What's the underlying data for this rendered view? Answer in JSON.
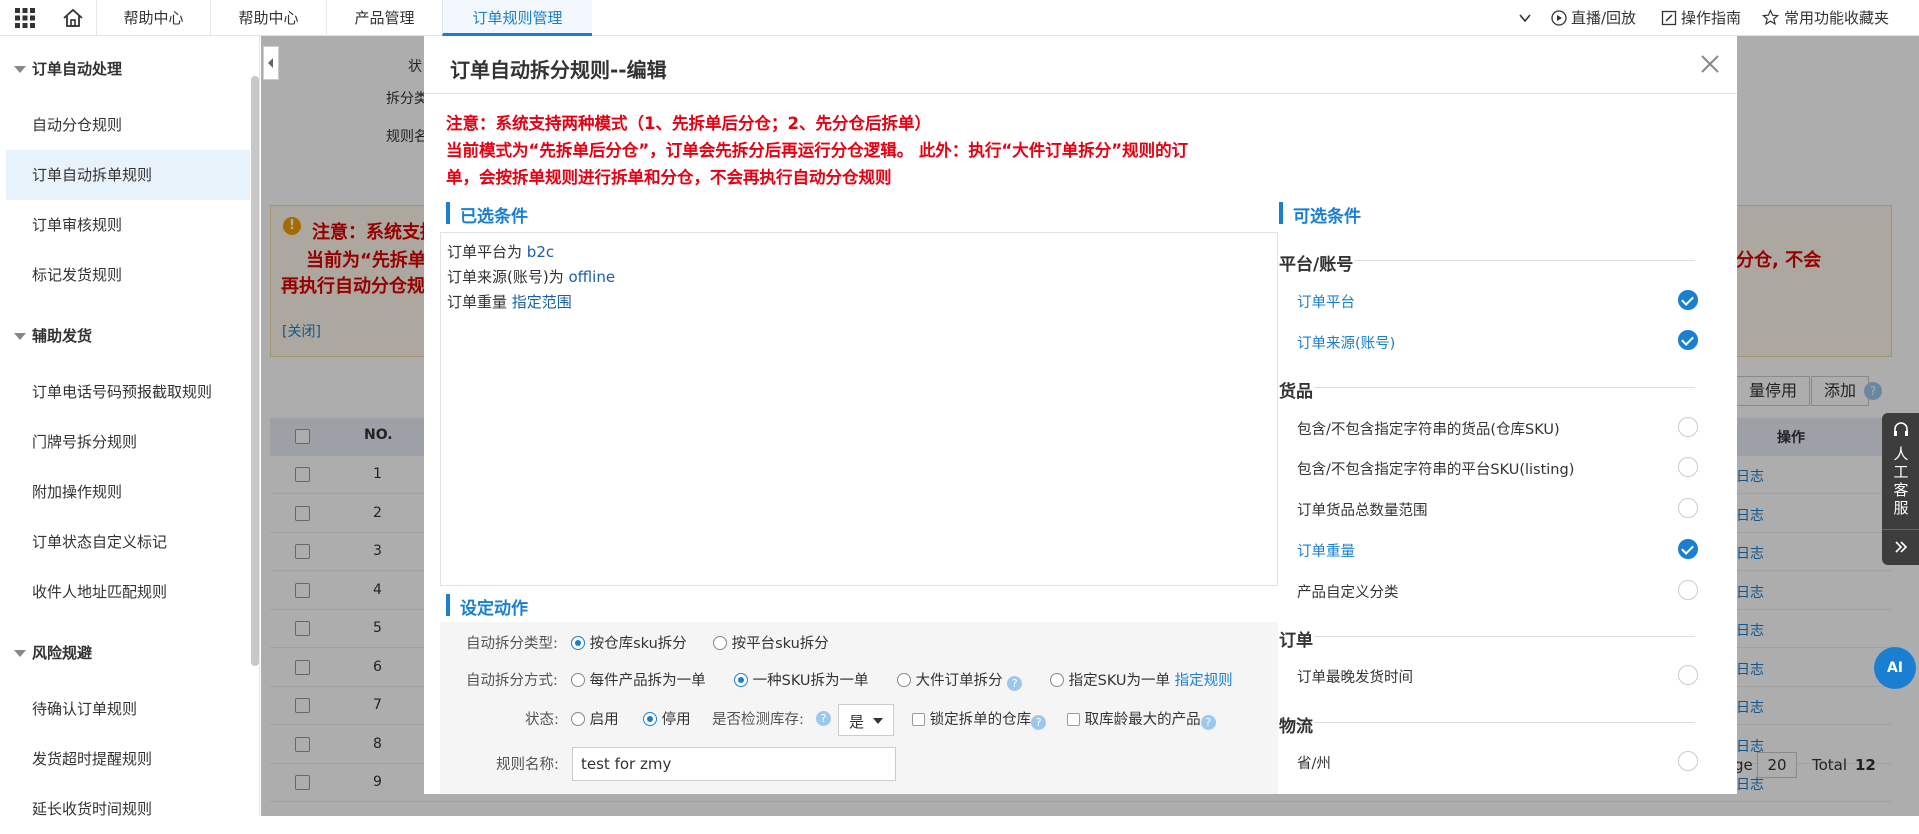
{
  "topbar": {
    "tabs": [
      "帮助中心",
      "帮助中心",
      "产品管理",
      "订单规则管理"
    ],
    "right": [
      "直播/回放",
      "操作指南",
      "常用功能收藏夹"
    ]
  },
  "sidebar": {
    "groups": [
      "订单自动处理",
      "辅助发货",
      "风险规避"
    ],
    "items1": [
      "自动分仓规则",
      "订单自动拆单规则",
      "订单审核规则",
      "标记发货规则"
    ],
    "items2": [
      "订单电话号码预报截取规则",
      "门牌号拆分规则",
      "附加操作规则",
      "订单状态自定义标记",
      "收件人地址匹配规则"
    ],
    "items3": [
      "待确认订单规则",
      "发货超时提醒规则",
      "延长收货时间规则"
    ]
  },
  "background": {
    "labels": [
      "状",
      "拆分类",
      "规则名"
    ],
    "notice_title": "注意：系统支持",
    "notice_line2": "当前为“先拆单",
    "notice_line3": "再执行自动分仓规则",
    "notice_right": "分仓, 不会",
    "close_link": "[关闭]",
    "btn_disable": "量停用",
    "btn_add": "添加",
    "col_no": "NO.",
    "col_op": "操作",
    "rows": [
      "1",
      "2",
      "3",
      "4",
      "5",
      "6",
      "7",
      "8",
      "9"
    ],
    "row_link": "日志",
    "pager_prefix": "ge",
    "page_size": "20",
    "total_label": "Total",
    "total": "12"
  },
  "modal": {
    "title": "订单自动拆分规则--编辑",
    "warning1": "注意：系统支持两种模式（1、先拆单后分仓；2、先分仓后拆单）",
    "warning2": "当前模式为“先拆单后分仓”，订单会先拆分后再运行分仓逻辑。 此外：执行“大件订单拆分”规则的订",
    "warning3": "单，会按拆单规则进行拆单和分仓，不会再执行自动分仓规则",
    "selected_title": "已选条件",
    "selected": [
      {
        "label": "订单平台为",
        "value": "b2c"
      },
      {
        "label": "订单来源(账号)为",
        "value": "offline"
      },
      {
        "label": "订单重量",
        "value": "指定范围"
      }
    ],
    "action_title": "设定动作",
    "split_type_label": "自动拆分类型:",
    "split_type_opts": [
      "按仓库sku拆分",
      "按平台sku拆分"
    ],
    "split_mode_label": "自动拆分方式:",
    "split_mode_opts": [
      "每件产品拆为一单",
      "一种SKU拆为一单",
      "大件订单拆分",
      "指定SKU为一单"
    ],
    "split_mode_link": "指定规则",
    "status_label": "状态:",
    "status_opts": [
      "启用",
      "停用"
    ],
    "stock_label": "是否检测库存:",
    "stock_value": "是",
    "lock_label": "锁定拆单的仓库",
    "age_label": "取库龄最大的产品",
    "name_label": "规则名称:",
    "name_value": "test for zmy",
    "available_title": "可选条件",
    "groups": [
      {
        "name": "平台/账号",
        "items": [
          {
            "label": "订单平台",
            "on": true
          },
          {
            "label": "订单来源(账号)",
            "on": true
          }
        ]
      },
      {
        "name": "货品",
        "items": [
          {
            "label": "包含/不包含指定字符串的货品(仓库SKU)",
            "on": false
          },
          {
            "label": "包含/不包含指定字符串的平台SKU(listing)",
            "on": false
          },
          {
            "label": "订单货品总数量范围",
            "on": false
          },
          {
            "label": "订单重量",
            "on": true
          },
          {
            "label": "产品自定义分类",
            "on": false
          }
        ]
      },
      {
        "name": "订单",
        "items": [
          {
            "label": "订单最晚发货时间",
            "on": false
          }
        ]
      },
      {
        "name": "物流",
        "items": [
          {
            "label": "省/州",
            "on": false
          }
        ]
      }
    ]
  },
  "service": {
    "label": "人工客服",
    "ai": "AI"
  }
}
